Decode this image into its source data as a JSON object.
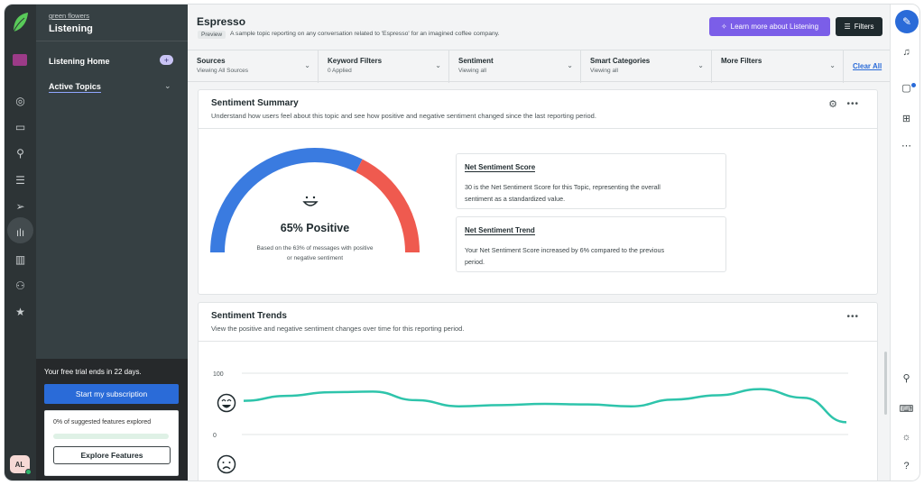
{
  "nav": {
    "breadcrumb": "green flowers",
    "title": "Listening",
    "items": [
      {
        "label": "Listening Home"
      },
      {
        "label": "Active Topics"
      }
    ]
  },
  "trial": {
    "text": "Your free trial ends in 22 days.",
    "cta": "Start my subscription",
    "progress_text": "0% of suggested features explored",
    "progress": 0,
    "explore": "Explore Features"
  },
  "user": {
    "initials": "AL"
  },
  "header": {
    "title": "Espresso",
    "badge": "Preview",
    "description": "A sample topic reporting on any conversation related to 'Espresso' for an imagined coffee company.",
    "learn_more": "Learn more about Listening",
    "filters": "Filters"
  },
  "filters": [
    {
      "label": "Sources",
      "value": "Viewing All Sources"
    },
    {
      "label": "Keyword Filters",
      "value": "0 Applied"
    },
    {
      "label": "Sentiment",
      "value": "Viewing all"
    },
    {
      "label": "Smart Categories",
      "value": "Viewing all"
    },
    {
      "label": "More Filters",
      "value": ""
    }
  ],
  "clear_all": "Clear All",
  "summary": {
    "title": "Sentiment Summary",
    "subtitle": "Understand how users feel about this topic and see how positive and negative sentiment changed since the last reporting period.",
    "gauge_label": "65% Positive",
    "gauge_note_1": "Based on the 63% of messages with positive",
    "gauge_note_2": "or negative sentiment",
    "positive_fraction": 0.65,
    "net_score_title": "Net Sentiment Score",
    "net_score_line1": "30 is the Net Sentiment Score for this Topic, representing the overall",
    "net_score_line2": "sentiment as a standardized value.",
    "net_trend_title": "Net Sentiment Trend",
    "net_trend_line1": "Your Net Sentiment Score increased by 6% compared to the previous",
    "net_trend_line2": "period."
  },
  "trends": {
    "title": "Sentiment Trends",
    "subtitle": "View the positive and negative sentiment changes over time for this reporting period.",
    "y_top": "100",
    "y_zero": "0"
  },
  "colors": {
    "positive": "#3a7be0",
    "negative": "#ef5a4f",
    "trend_line": "#2ec4ab",
    "accent": "#7b5ee8"
  },
  "chart_data": {
    "type": "line",
    "ylim": [
      -40,
      100
    ],
    "x": [
      0,
      1,
      2,
      3,
      4,
      5,
      6,
      7,
      8,
      9,
      10,
      11,
      12,
      13,
      14
    ],
    "series": [
      {
        "values": [
          55,
          63,
          69,
          70,
          56,
          46,
          48,
          50,
          49,
          46,
          57,
          64,
          74,
          60,
          20
        ]
      }
    ]
  }
}
